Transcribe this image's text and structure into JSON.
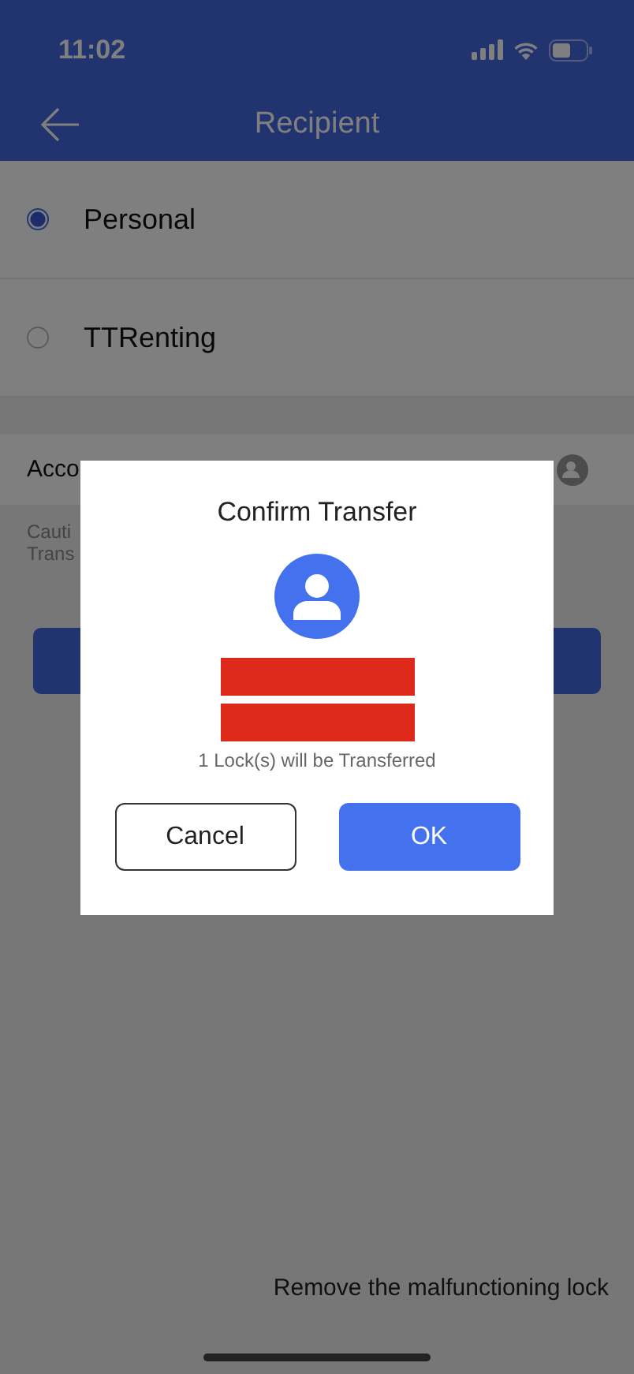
{
  "status_bar": {
    "time": "11:02"
  },
  "header": {
    "title": "Recipient"
  },
  "recipient_options": [
    {
      "label": "Personal",
      "selected": true
    },
    {
      "label": "TTRenting",
      "selected": false
    }
  ],
  "account": {
    "label": "Acco"
  },
  "caution": [
    "Cauti",
    "Trans"
  ],
  "footer_link": "Remove the malfunctioning lock",
  "dialog": {
    "title": "Confirm Transfer",
    "message": "1 Lock(s) will be Transferred",
    "buttons": [
      {
        "label": "Cancel",
        "kind": "secondary"
      },
      {
        "label": "OK",
        "kind": "primary"
      }
    ]
  }
}
